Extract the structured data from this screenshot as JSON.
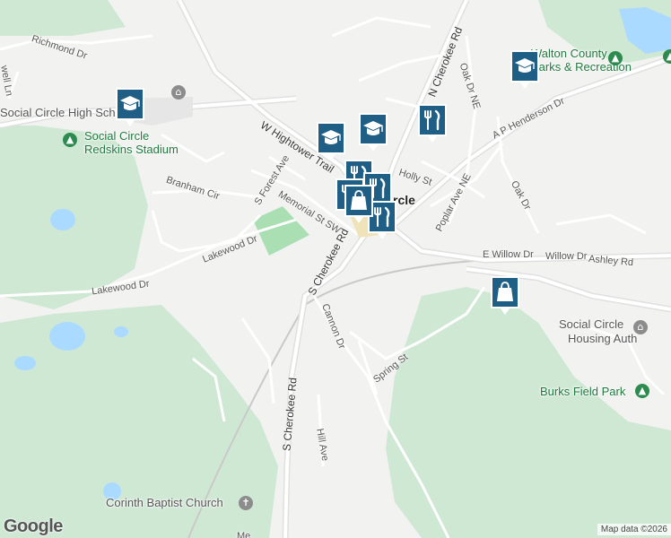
{
  "map": {
    "colors": {
      "land": "#f2f2f0",
      "park": "#cfe8d4",
      "field": "#a9dfb2",
      "water": "#aadaff",
      "road": "#ffffff",
      "major_road": "#e2e2e2",
      "rail": "#bdbdbd",
      "pin": "#1f5f86",
      "poi_green": "#1e7a3e",
      "poi_gray": "#6e6e6e"
    },
    "town_label": "Social Circle",
    "town_label_visible": "Circle",
    "streets": {
      "richmond": "Richmond Dr",
      "well": "well Ln",
      "w_hightower": "W Hightower Trail",
      "n_cherokee": "N Cherokee Rd",
      "oak_ne": "Oak Dr NE",
      "ap_henderson": "A P Henderson Dr",
      "holly": "Holly St",
      "poplar": "Poplar Ave NE",
      "oak": "Oak Dr",
      "branham": "Branham Cir",
      "s_forest": "S Forest Ave",
      "memorial": "Memorial St SW",
      "lakewood_dr_1": "Lakewood Dr",
      "lakewood_dr_2": "Lakewood Dr",
      "s_cherokee_1": "S Cherokee Rd",
      "s_cherokee_2": "S Cherokee Rd",
      "e_willow": "E Willow Dr",
      "willow": "Willow Dr",
      "ashley": "Ashley Rd",
      "cannon": "Cannon Dr",
      "spring": "Spring St",
      "hill": "Hill Ave",
      "me": "Me"
    },
    "pois": {
      "high_school": "Social Circle High School",
      "stadium_line1": "Social Circle",
      "stadium_line2": "Redskins Stadium",
      "walton_line1": "Walton County",
      "walton_line2": "Parks & Recreation",
      "housing_line1": "Social Circle",
      "housing_line2": "Housing Auth",
      "burks": "Burks Field Park",
      "corinth": "Corinth Baptist Church"
    },
    "markers": [
      {
        "type": "school",
        "icon": "school-icon"
      },
      {
        "type": "school",
        "icon": "school-icon"
      },
      {
        "type": "school",
        "icon": "school-icon"
      },
      {
        "type": "school",
        "icon": "school-icon"
      },
      {
        "type": "restaurant",
        "icon": "fork-knife-icon"
      },
      {
        "type": "restaurant",
        "icon": "fork-knife-icon"
      },
      {
        "type": "restaurant",
        "icon": "fork-knife-icon"
      },
      {
        "type": "restaurant",
        "icon": "fork-knife-icon"
      },
      {
        "type": "restaurant",
        "icon": "fork-knife-icon"
      },
      {
        "type": "shopping",
        "icon": "shopping-bag-icon"
      },
      {
        "type": "shopping",
        "icon": "shopping-bag-icon"
      }
    ],
    "logo": "Google",
    "attribution": "Map data ©2026"
  }
}
